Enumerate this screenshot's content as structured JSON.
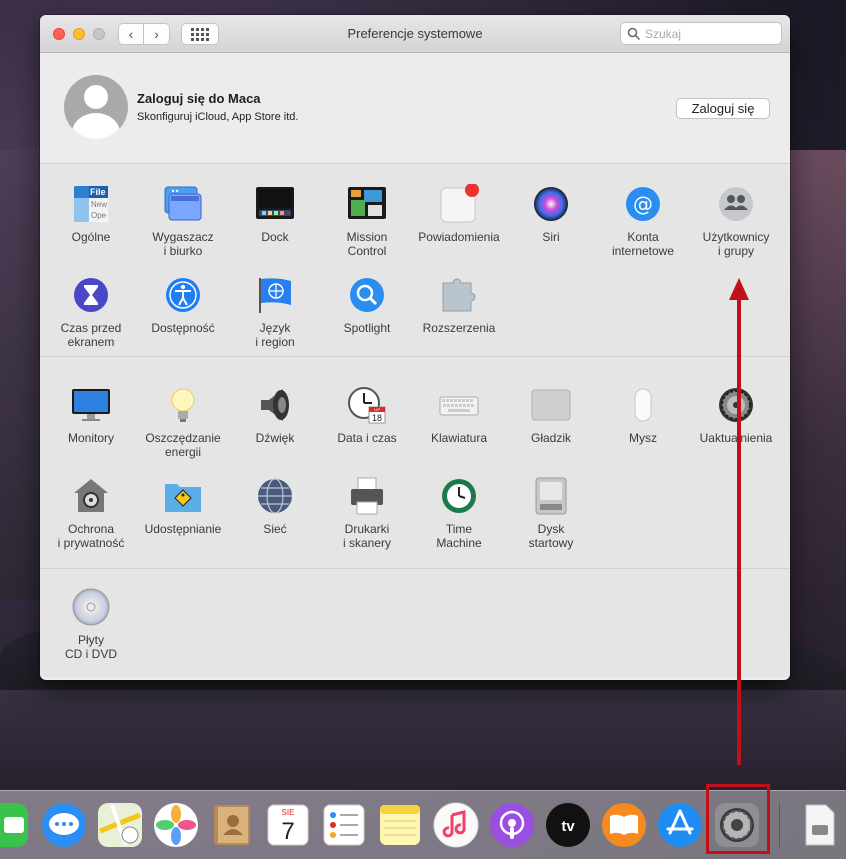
{
  "window": {
    "title": "Preferencje systemowe",
    "search_placeholder": "Szukaj"
  },
  "account": {
    "title": "Zaloguj się do Maca",
    "subtitle": "Skonfiguruj iCloud, App Store itd.",
    "button": "Zaloguj się"
  },
  "panes_row1": [
    {
      "label": "Ogólne",
      "icon": "general-icon"
    },
    {
      "label": "Wygaszacz\ni biurko",
      "icon": "desktop-screensaver-icon"
    },
    {
      "label": "Dock",
      "icon": "dock-icon"
    },
    {
      "label": "Mission\nControl",
      "icon": "mission-control-icon"
    },
    {
      "label": "Powiadomienia",
      "icon": "notifications-icon"
    },
    {
      "label": "Siri",
      "icon": "siri-icon"
    },
    {
      "label": "Konta\ninternetowe",
      "icon": "internet-accounts-icon"
    },
    {
      "label": "Użytkownicy\ni grupy",
      "icon": "users-groups-icon"
    }
  ],
  "panes_row2": [
    {
      "label": "Czas przed\nekranem",
      "icon": "screen-time-icon"
    },
    {
      "label": "Dostępność",
      "icon": "accessibility-icon"
    },
    {
      "label": "Język\ni region",
      "icon": "language-region-icon"
    },
    {
      "label": "Spotlight",
      "icon": "spotlight-icon"
    },
    {
      "label": "Rozszerzenia",
      "icon": "extensions-icon"
    }
  ],
  "panes_row3": [
    {
      "label": "Monitory",
      "icon": "displays-icon"
    },
    {
      "label": "Oszczędzanie\nenergii",
      "icon": "energy-saver-icon"
    },
    {
      "label": "Dźwięk",
      "icon": "sound-icon"
    },
    {
      "label": "Data i czas",
      "icon": "date-time-icon"
    },
    {
      "label": "Klawiatura",
      "icon": "keyboard-icon"
    },
    {
      "label": "Gładzik",
      "icon": "trackpad-icon"
    },
    {
      "label": "Mysz",
      "icon": "mouse-icon"
    },
    {
      "label": "Uaktualnienia",
      "icon": "software-update-icon"
    }
  ],
  "panes_row4": [
    {
      "label": "Ochrona\ni prywatność",
      "icon": "security-privacy-icon"
    },
    {
      "label": "Udostępnianie",
      "icon": "sharing-icon"
    },
    {
      "label": "Sieć",
      "icon": "network-icon"
    },
    {
      "label": "Drukarki\ni skanery",
      "icon": "printers-scanners-icon"
    },
    {
      "label": "Time\nMachine",
      "icon": "time-machine-icon"
    },
    {
      "label": "Dysk\nstartowy",
      "icon": "startup-disk-icon"
    }
  ],
  "panes_row5": [
    {
      "label": "Płyty\nCD i DVD",
      "icon": "cds-dvds-icon"
    }
  ],
  "icon_texts": {
    "general_file": "File",
    "general_new": "New",
    "general_open": "Ope",
    "date_month": "LIP",
    "date_day": "18",
    "calendar_month": "SIE",
    "calendar_day": "7",
    "tv_label": "tv"
  },
  "dock": [
    "facetime-icon",
    "messages-icon",
    "maps-icon",
    "photos-icon",
    "contacts-icon",
    "calendar-icon",
    "reminders-icon",
    "notes-icon",
    "music-icon",
    "podcasts-icon",
    "apple-tv-icon",
    "books-icon",
    "app-store-icon",
    "system-preferences-icon",
    "downloads-icon"
  ],
  "colors": {
    "annotation": "#c0111a",
    "close": "#fe5f57",
    "minimize": "#febc2e"
  }
}
